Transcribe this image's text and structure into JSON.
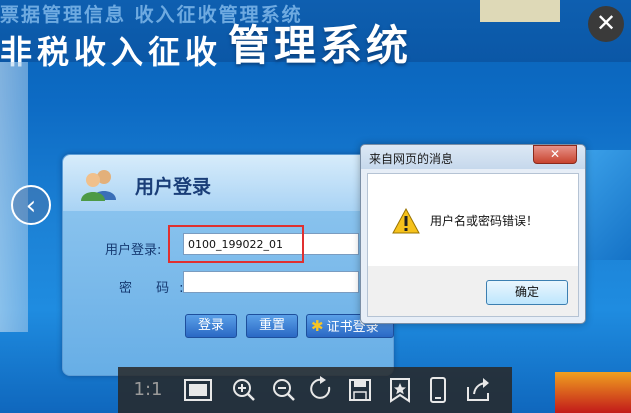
{
  "background": {
    "banner_top_text": "票据管理信息 收入征收管理系统",
    "banner_main_text": "非税收入征收",
    "banner_title": "管理系统"
  },
  "viewer": {
    "close_glyph": "✕",
    "prev_glyph": "‹",
    "toolbar": {
      "ratio_label": "1:1",
      "icons": [
        "fit-screen-icon",
        "zoom-in-icon",
        "zoom-out-icon",
        "rotate-icon",
        "save-icon",
        "bookmark-icon",
        "mobile-icon",
        "share-icon"
      ]
    }
  },
  "login": {
    "title": "用户登录",
    "user_label": "用户登录:",
    "password_label": "密 码:",
    "user_value": "0100_199022_01",
    "password_value": "",
    "login_button": "登录",
    "reset_button": "重置",
    "cert_button": "证书登录"
  },
  "dialog": {
    "title": "来自网页的消息",
    "close_glyph": "✕",
    "message": "用户名或密码错误！",
    "ok_button": "确定"
  },
  "colors": {
    "highlight_border": "#e03030",
    "accent_blue": "#2a68c4"
  }
}
